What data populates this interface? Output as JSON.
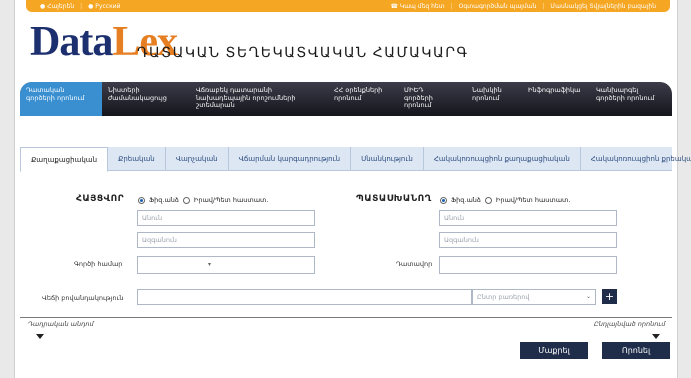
{
  "topbar": {
    "left": [
      "● Հայերեն",
      "|",
      "● Русский"
    ],
    "right": [
      "☎ Կապ մեզ հետ",
      "|",
      "Օգտագործման պայման",
      "|",
      "Մասնակցել Տվյալներին բազային"
    ]
  },
  "logo": {
    "data": "Data",
    "lex": "Lex",
    "subtitle": "ԴԱՏԱԿԱՆ ՏԵՂԵԿԱՏՎԱԿԱՆ ՀԱՄԱԿԱՐԳ"
  },
  "nav": {
    "items": [
      {
        "label": "Դատական\nգործերի որոնում"
      },
      {
        "label": "Նիստերի\nժամանակացույց"
      },
      {
        "label": "Վճռաբեկ դատարանի\nնախադեպային որոշումների\nշտեմարան"
      },
      {
        "label": "ՀՀ օրենքների\nորոնում"
      },
      {
        "label": "ՄԻԵԴ\nգործերի\nորոնում"
      },
      {
        "label": "Նախկին\nորոնում"
      },
      {
        "label": "Ինֆոգրաֆիկա"
      },
      {
        "label": "Կանխարգել\nգործերի որոնում"
      }
    ]
  },
  "tabs": [
    "Քաղաքացիական",
    "Քրեական",
    "Վարչական",
    "Վճարման կարգադրություն",
    "Սնանկություն",
    "Հակակոռուպցիոն քաղաքացիական",
    "Հակակոռուպցիոն քրեական"
  ],
  "form": {
    "plaintiff_title": "ՀԱՅՑՎՈՐ",
    "defendant_title": "ՊԱՏԱՍԽԱՆՈՂ",
    "radio_physical": "Ֆիզ.անձ",
    "radio_legal": "Իրավ/Պետ հաստատ.",
    "name_placeholder": "Անուն",
    "surname_placeholder": "Ազգանուն",
    "case_number_label": "Գործի համար",
    "judge_label": "Դատավոր",
    "claim_label": "Վեճի բովանդակություն",
    "claim_select": "Ընտր բառերով",
    "plus": "+",
    "left_link": "Դադրական անդոմ",
    "right_link": "Ընդլայնված որոնում",
    "clear_button": "Մաքրել",
    "search_button": "Որոնել"
  }
}
